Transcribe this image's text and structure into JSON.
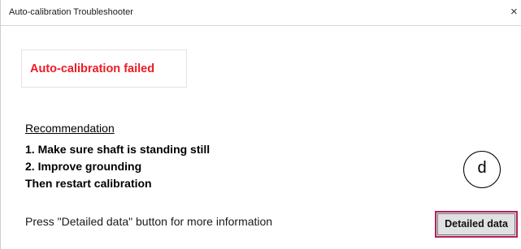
{
  "window": {
    "title": "Auto-calibration Troubleshooter",
    "close_glyph": "×"
  },
  "status": {
    "message": "Auto-calibration failed",
    "color": "#ee1b24"
  },
  "recommendation": {
    "heading": "Recommendation",
    "steps": [
      "1. Make sure shaft is standing still",
      "2. Improve grounding",
      "Then restart calibration"
    ]
  },
  "footer": {
    "hint": "Press \"Detailed data\" button for more information",
    "detail_button_label": "Detailed data",
    "detail_button_highlight_color": "#b5205d"
  },
  "annotation": {
    "callout_label": "d"
  }
}
